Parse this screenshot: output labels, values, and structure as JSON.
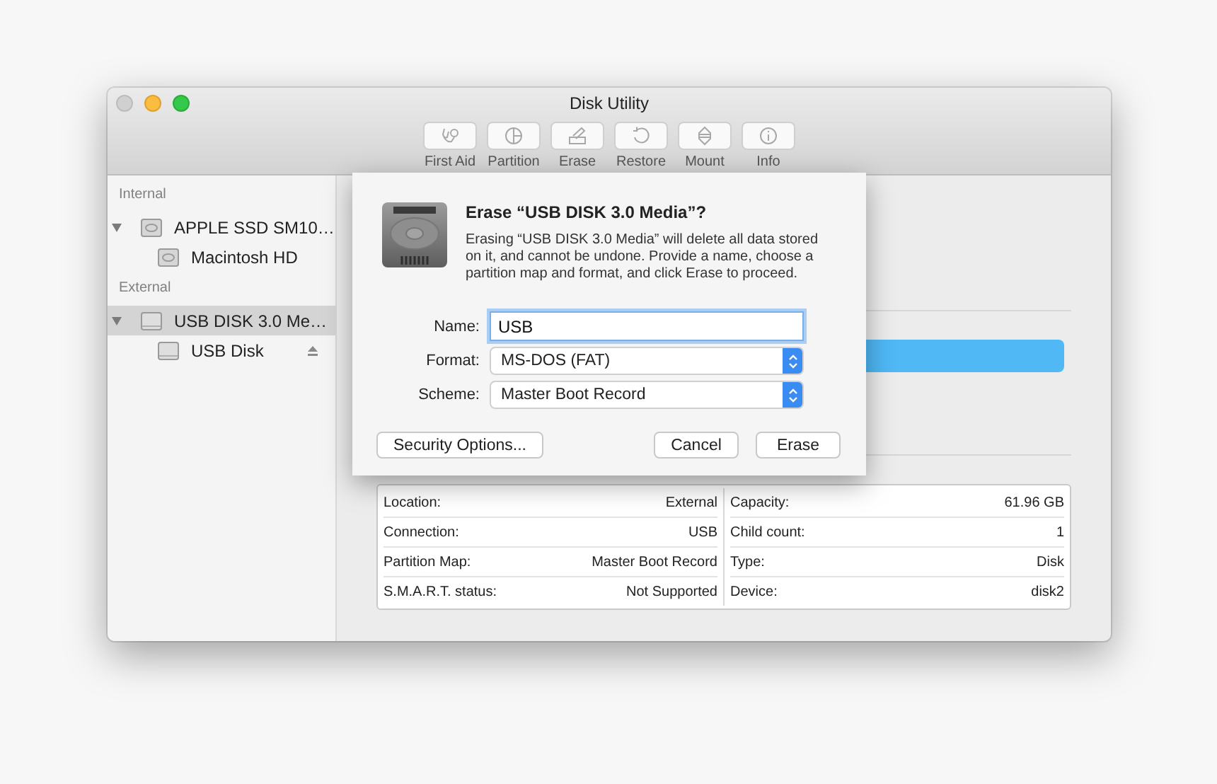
{
  "window": {
    "title": "Disk Utility"
  },
  "toolbar": [
    {
      "label": "First Aid",
      "kind": "first-aid"
    },
    {
      "label": "Partition",
      "kind": "partition"
    },
    {
      "label": "Erase",
      "kind": "erase"
    },
    {
      "label": "Restore",
      "kind": "restore"
    },
    {
      "label": "Mount",
      "kind": "mount"
    },
    {
      "label": "Info",
      "kind": "info"
    }
  ],
  "sidebar": {
    "sections": [
      {
        "title": "Internal",
        "items": [
          {
            "label": "APPLE SSD SM10…",
            "kind": "internal",
            "expanded": true,
            "selected": false,
            "children": [
              {
                "label": "Macintosh HD",
                "kind": "internal",
                "selected": false,
                "ejectable": false
              }
            ]
          }
        ]
      },
      {
        "title": "External",
        "items": [
          {
            "label": "USB DISK 3.0 Me…",
            "kind": "external",
            "expanded": true,
            "selected": true,
            "children": [
              {
                "label": "USB Disk",
                "kind": "external",
                "selected": false,
                "ejectable": true
              }
            ]
          }
        ]
      }
    ]
  },
  "dialog": {
    "title": "Erase “USB DISK 3.0 Media”?",
    "message": "Erasing “USB DISK 3.0 Media” will delete all data stored on it, and cannot be undone. Provide a name, choose a partition map and format, and click Erase to proceed.",
    "fields": [
      {
        "label": "Name:",
        "kind": "text",
        "value": "USB"
      },
      {
        "label": "Format:",
        "kind": "popup",
        "value": "MS-DOS (FAT)"
      },
      {
        "label": "Scheme:",
        "kind": "popup",
        "value": "Master Boot Record"
      }
    ],
    "buttons": [
      {
        "label": "Security Options...",
        "kind": "left"
      },
      {
        "label": "Cancel",
        "kind": "right"
      },
      {
        "label": "Erase",
        "kind": "right"
      }
    ]
  },
  "info": {
    "left": [
      {
        "label": "Location:",
        "value": "External"
      },
      {
        "label": "Connection:",
        "value": "USB"
      },
      {
        "label": "Partition Map:",
        "value": "Master Boot Record"
      },
      {
        "label": "S.M.A.R.T. status:",
        "value": "Not Supported"
      }
    ],
    "right": [
      {
        "label": "Capacity:",
        "value": "61.96 GB"
      },
      {
        "label": "Child count:",
        "value": "1"
      },
      {
        "label": "Type:",
        "value": "Disk"
      },
      {
        "label": "Device:",
        "value": "disk2"
      }
    ]
  }
}
